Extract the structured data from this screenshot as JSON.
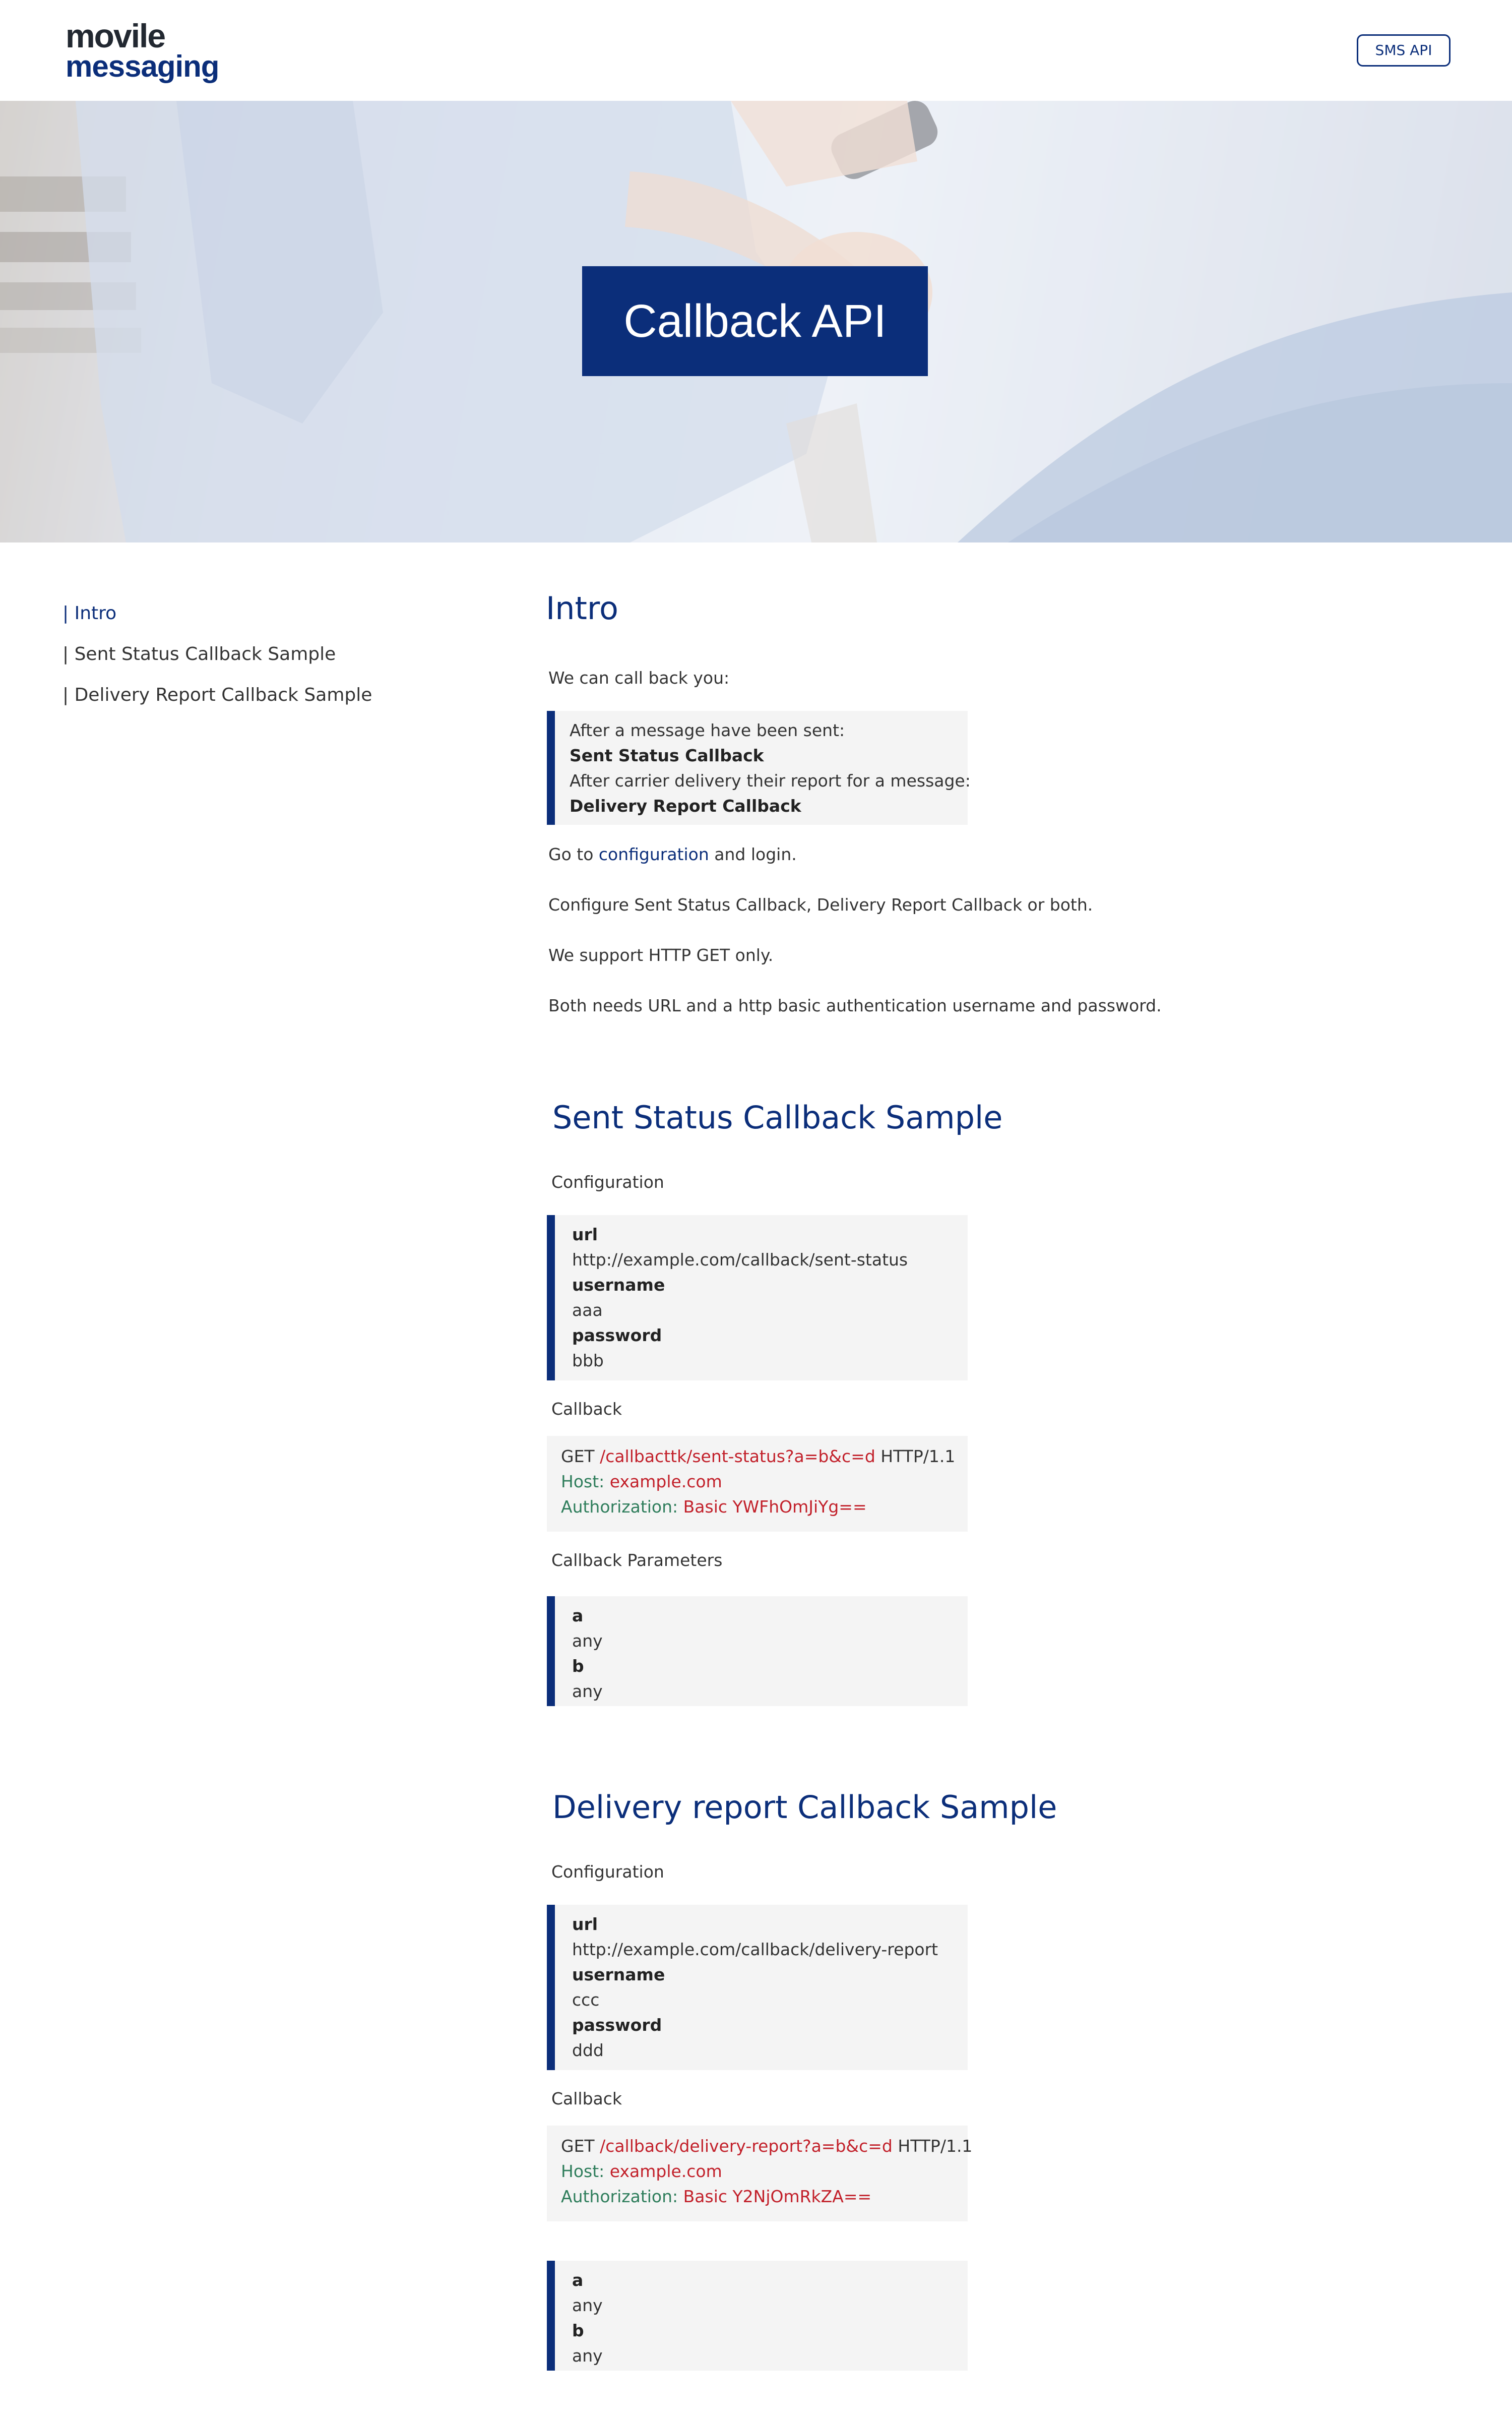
{
  "header": {
    "logo_top": "movile",
    "logo_bottom": "messaging",
    "sms_api_label": "SMS API"
  },
  "hero": {
    "title": "Callback API"
  },
  "sidebar": {
    "items": [
      {
        "label": "| Intro",
        "active": true
      },
      {
        "label": "| Sent Status Callback Sample",
        "active": false
      },
      {
        "label": "| Delivery Report Callback Sample",
        "active": false
      }
    ]
  },
  "intro": {
    "heading": "Intro",
    "lead": "We can call back you:",
    "callouts": [
      "After a message have been sent:",
      "Sent Status Callback",
      "After carrier delivery their report for a message:",
      "Delivery Report Callback"
    ],
    "goto_prefix": "Go to ",
    "goto_link": "configuration",
    "goto_suffix": " and login.",
    "configure": "Configure Sent Status Callback, Delivery Report Callback or both.",
    "support": "We support HTTP GET only.",
    "auth": "Both needs URL and a http basic authentication username and password."
  },
  "sent_status": {
    "heading": "Sent Status Callback Sample",
    "config_label": "Configuration",
    "config": {
      "url_key": "url",
      "url_value": "http://example.com/callback/sent-status",
      "username_key": "username",
      "username_value": "aaa",
      "password_key": "password",
      "password_value": "bbb"
    },
    "callback_label": "Callback",
    "request": {
      "method": "GET ",
      "path": "/callbacttk/sent-status?a=b&c=d",
      "protocol": " HTTP/1.1",
      "host_key": "Host",
      "host_value": "example.com",
      "auth_key": "Authorization",
      "auth_value": "Basic YWFhOmJiYg=="
    },
    "params_label": "Callback Parameters",
    "params": {
      "a_key": "a",
      "a_value": "any",
      "b_key": "b",
      "b_value": "any"
    }
  },
  "delivery_report": {
    "heading": "Delivery report Callback Sample",
    "config_label": "Configuration",
    "config": {
      "url_key": "url",
      "url_value": "http://example.com/callback/delivery-report",
      "username_key": "username",
      "username_value": "ccc",
      "password_key": "password",
      "password_value": "ddd"
    },
    "callback_label": "Callback",
    "request": {
      "method": "GET ",
      "path": "/callback/delivery-report?a=b&c=d",
      "protocol": " HTTP/1.1",
      "host_key": "Host",
      "host_value": "example.com",
      "auth_key": "Authorization",
      "auth_value": "Basic Y2NjOmRkZA=="
    },
    "params": {
      "a_key": "a",
      "a_value": "any",
      "b_key": "b",
      "b_value": "any"
    }
  },
  "colors": {
    "brand": "#0b2e7a",
    "code_red": "#c2202a",
    "code_green": "#2e7d5b",
    "box_bg": "#f4f4f4"
  }
}
